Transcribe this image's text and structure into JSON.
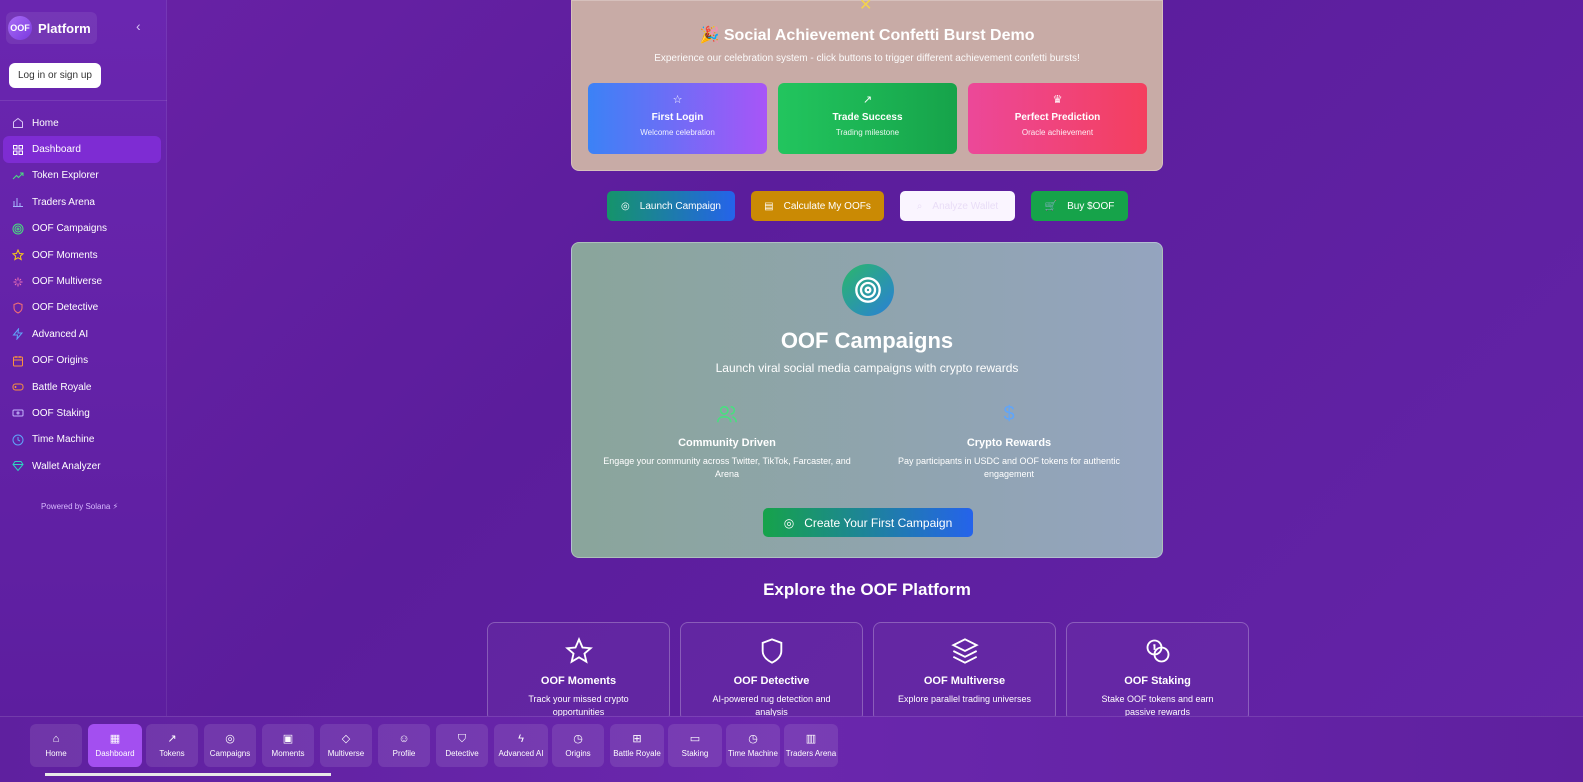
{
  "sidebar": {
    "brand_logo": "OOF",
    "brand_name": "Platform",
    "collapse_icon": "chevron-left-icon",
    "login_label": "Log in or sign up",
    "items": [
      {
        "label": "Home",
        "icon": "home-icon",
        "color": "#d8c4f5"
      },
      {
        "label": "Dashboard",
        "icon": "grid-icon",
        "color": "#ffffff"
      },
      {
        "label": "Token Explorer",
        "icon": "trending-up-icon",
        "color": "#4ade80"
      },
      {
        "label": "Traders Arena",
        "icon": "bar-chart-icon",
        "color": "#a5b4fc"
      },
      {
        "label": "OOF Campaigns",
        "icon": "target-icon",
        "color": "#4ade80"
      },
      {
        "label": "OOF Moments",
        "icon": "star-icon",
        "color": "#facc15"
      },
      {
        "label": "OOF Multiverse",
        "icon": "sparkle-icon",
        "color": "#f472b6"
      },
      {
        "label": "OOF Detective",
        "icon": "shield-icon",
        "color": "#f87171"
      },
      {
        "label": "Advanced AI",
        "icon": "zap-icon",
        "color": "#60a5fa"
      },
      {
        "label": "OOF Origins",
        "icon": "calendar-icon",
        "color": "#fb923c"
      },
      {
        "label": "Battle Royale",
        "icon": "gamepad-icon",
        "color": "#fb923c"
      },
      {
        "label": "OOF Staking",
        "icon": "coin-icon",
        "color": "#c4b5fd"
      },
      {
        "label": "Time Machine",
        "icon": "clock-icon",
        "color": "#60a5fa"
      },
      {
        "label": "Wallet Analyzer",
        "icon": "gem-icon",
        "color": "#2dd4bf"
      }
    ],
    "powered": "Powered by Solana ⚡"
  },
  "confetti": {
    "title": "🎉 Social Achievement Confetti Burst Demo",
    "subtitle": "Experience our celebration system - click buttons to trigger different achievement confetti bursts!",
    "achievements": [
      {
        "title": "First Login",
        "subtitle": "Welcome celebration",
        "icon": "☆"
      },
      {
        "title": "Trade Success",
        "subtitle": "Trading milestone",
        "icon": "↗"
      },
      {
        "title": "Perfect Prediction",
        "subtitle": "Oracle achievement",
        "icon": "♛"
      }
    ]
  },
  "actions": {
    "launch": "Launch Campaign",
    "calculate": "Calculate My OOFs",
    "analyze": "Analyze Wallet",
    "buy": "Buy $OOF"
  },
  "campaigns": {
    "title": "OOF Campaigns",
    "subtitle": "Launch viral social media campaigns with crypto rewards",
    "features": [
      {
        "title": "Community Driven",
        "desc": "Engage your community across Twitter, TikTok, Farcaster, and Arena"
      },
      {
        "title": "Crypto Rewards",
        "desc": "Pay participants in USDC and OOF tokens for authentic engagement"
      }
    ],
    "cta": "Create Your First Campaign"
  },
  "explore": {
    "title": "Explore the OOF Platform",
    "tiles": [
      {
        "title": "OOF Moments",
        "desc": "Track your missed crypto opportunities",
        "icon": "star-icon"
      },
      {
        "title": "OOF Detective",
        "desc": "AI-powered rug detection and analysis",
        "icon": "shield-icon"
      },
      {
        "title": "OOF Multiverse",
        "desc": "Explore parallel trading universes",
        "icon": "layers-icon"
      },
      {
        "title": "OOF Staking",
        "desc": "Stake OOF tokens and earn passive rewards",
        "icon": "coins-icon"
      }
    ]
  },
  "bottom_nav": [
    {
      "label": "Home",
      "icon": "⌂"
    },
    {
      "label": "Dashboard",
      "icon": "▦"
    },
    {
      "label": "Tokens",
      "icon": "↗"
    },
    {
      "label": "Campaigns",
      "icon": "◎"
    },
    {
      "label": "Moments",
      "icon": "▣"
    },
    {
      "label": "Multiverse",
      "icon": "◇"
    },
    {
      "label": "Profile",
      "icon": "☺"
    },
    {
      "label": "Detective",
      "icon": "⛉"
    },
    {
      "label": "Advanced AI",
      "icon": "ϟ"
    },
    {
      "label": "Origins",
      "icon": "◷"
    },
    {
      "label": "Battle Royale",
      "icon": "⊞"
    },
    {
      "label": "Staking",
      "icon": "▭"
    },
    {
      "label": "Time Machine",
      "icon": "◷"
    },
    {
      "label": "Traders Arena",
      "icon": "▥"
    }
  ]
}
